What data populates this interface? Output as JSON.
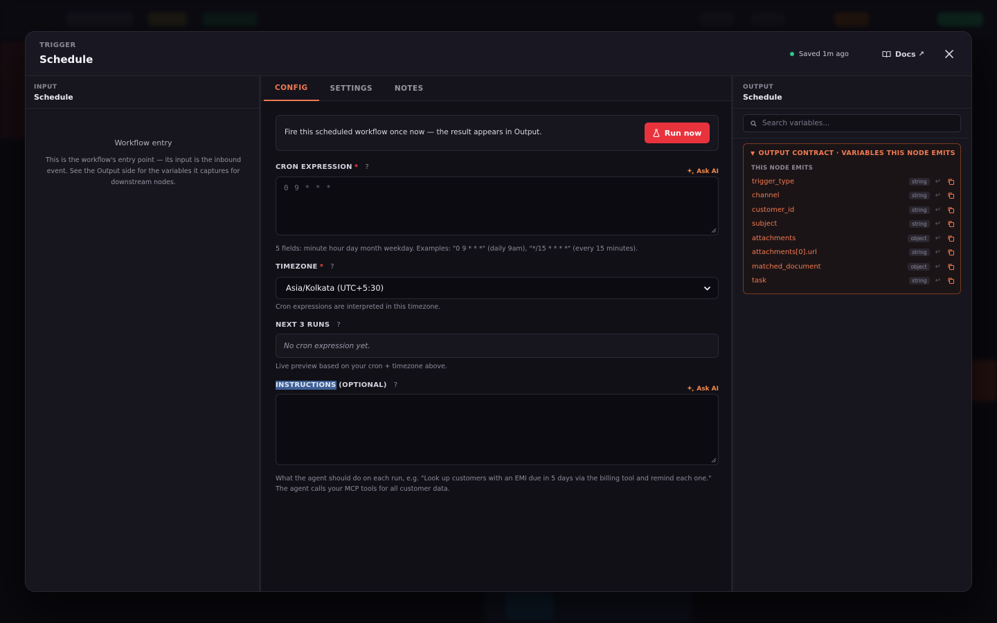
{
  "header": {
    "kicker": "TRIGGER",
    "title": "Schedule",
    "saved_status": "Saved 1m ago",
    "docs_label": "Docs",
    "docs_ext": "↗"
  },
  "input_panel": {
    "kicker": "INPUT",
    "title": "Schedule",
    "entry_title": "Workflow entry",
    "entry_desc": "This is the workflow's entry point — its input is the inbound event. See the Output side for the variables it captures for downstream nodes."
  },
  "tabs": [
    {
      "label": "CONFIG",
      "active": true
    },
    {
      "label": "SETTINGS",
      "active": false
    },
    {
      "label": "NOTES",
      "active": false
    }
  ],
  "run_box": {
    "message": "Fire this scheduled workflow once now — the result appears in Output.",
    "button_label": "Run now"
  },
  "cron": {
    "label": "CRON EXPRESSION",
    "required_mark": "*",
    "help": "?",
    "ask_ai": "Ask AI",
    "placeholder": "0 9 * * *",
    "hint": "5 fields: minute hour day month weekday. Examples: \"0 9 * * *\" (daily 9am), \"*/15 * * * *\" (every 15 minutes)."
  },
  "timezone": {
    "label": "TIMEZONE",
    "required_mark": "*",
    "help": "?",
    "value": "Asia/Kolkata (UTC+5:30)",
    "hint": "Cron expressions are interpreted in this timezone."
  },
  "next_runs": {
    "label": "NEXT 3 RUNS",
    "help": "?",
    "empty_text": "No cron expression yet.",
    "hint": "Live preview based on your cron + timezone above."
  },
  "instructions": {
    "label_highlight": "INSTRUCTIONS",
    "label_rest": " (OPTIONAL)",
    "help": "?",
    "ask_ai": "Ask AI",
    "hint_line1": "What the agent should do on each run, e.g. \"Look up customers with an EMI due in 5 days via the billing tool and remind each one.\"",
    "hint_line2": "The agent calls your MCP tools for all customer data."
  },
  "output_panel": {
    "kicker": "OUTPUT",
    "title": "Schedule",
    "search_placeholder": "Search variables...",
    "contract_title": "OUTPUT CONTRACT · VARIABLES THIS NODE EMITS",
    "emits_label": "THIS NODE EMITS",
    "variables": [
      {
        "name": "trigger_type",
        "type": "string"
      },
      {
        "name": "channel",
        "type": "string"
      },
      {
        "name": "customer_id",
        "type": "string"
      },
      {
        "name": "subject",
        "type": "string"
      },
      {
        "name": "attachments",
        "type": "object"
      },
      {
        "name": "attachments[0].url",
        "type": "string"
      },
      {
        "name": "matched_document",
        "type": "object"
      },
      {
        "name": "task",
        "type": "string"
      }
    ]
  },
  "colors": {
    "accent": "#f07a52",
    "danger": "#e8333d",
    "saved_dot": "#2ec98b"
  }
}
